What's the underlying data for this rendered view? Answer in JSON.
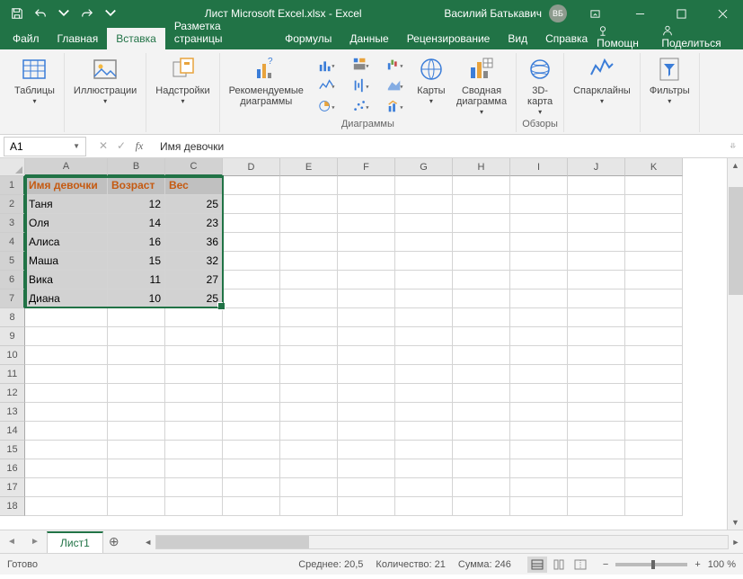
{
  "titlebar": {
    "title": "Лист Microsoft Excel.xlsx - Excel",
    "username": "Василий Батькавич",
    "avatar_initials": "ВБ"
  },
  "tabs": {
    "items": [
      "Файл",
      "Главная",
      "Вставка",
      "Разметка страницы",
      "Формулы",
      "Данные",
      "Рецензирование",
      "Вид",
      "Справка"
    ],
    "active_index": 2,
    "tell_me": "Помощн",
    "share": "Поделиться"
  },
  "ribbon": {
    "tables": "Таблицы",
    "illustrations": "Иллюстрации",
    "addins": "Надстройки",
    "rec_charts": "Рекомендуемые\nдиаграммы",
    "charts_group": "Диаграммы",
    "maps": "Карты",
    "pivot": "Сводная\nдиаграмма",
    "map3d": "3D-\nкарта",
    "tours": "Обзоры",
    "sparklines": "Спарклайны",
    "filters": "Фильтры"
  },
  "formula_bar": {
    "name": "A1",
    "formula": "Имя девочки"
  },
  "grid": {
    "columns": [
      "A",
      "B",
      "C",
      "D",
      "E",
      "F",
      "G",
      "H",
      "I",
      "J",
      "K"
    ],
    "row_count": 18,
    "selected_cols": 3,
    "selected_rows": 7,
    "headers": [
      "Имя девочки",
      "Возраст",
      "Вес"
    ],
    "data": [
      [
        "Таня",
        "12",
        "25"
      ],
      [
        "Оля",
        "14",
        "23"
      ],
      [
        "Алиса",
        "16",
        "36"
      ],
      [
        "Маша",
        "15",
        "32"
      ],
      [
        "Вика",
        "11",
        "27"
      ],
      [
        "Диана",
        "10",
        "25"
      ]
    ]
  },
  "sheets": {
    "active": "Лист1"
  },
  "status": {
    "ready": "Готово",
    "avg_label": "Среднее:",
    "avg": "20,5",
    "count_label": "Количество:",
    "count": "21",
    "sum_label": "Сумма:",
    "sum": "246",
    "zoom": "100 %"
  }
}
